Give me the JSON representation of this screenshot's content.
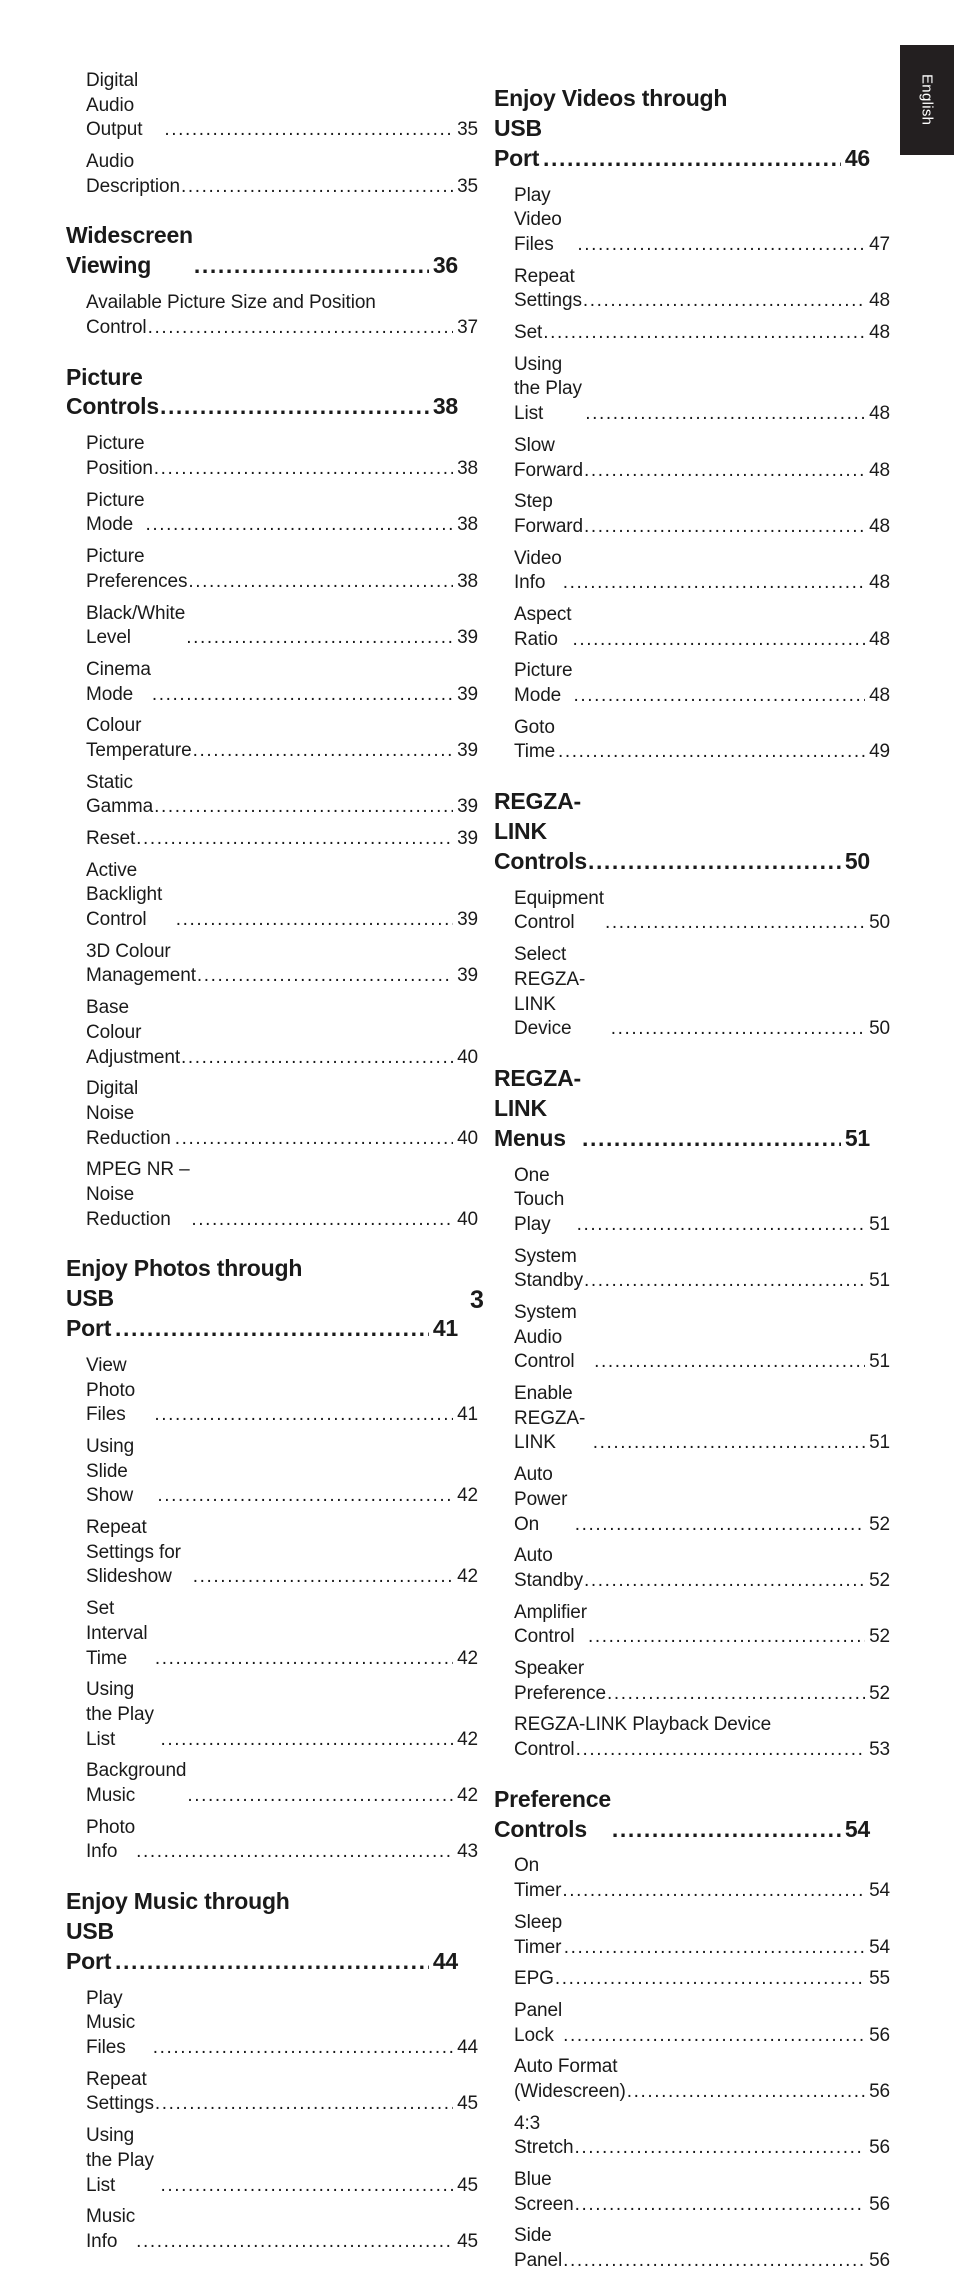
{
  "document": {
    "page_number": "3",
    "language_tab": "English"
  },
  "left_column": [
    {
      "kind": "item",
      "title": "Digital Audio Output",
      "page": "35"
    },
    {
      "kind": "item",
      "title": "Audio Description ",
      "page": "35"
    },
    {
      "kind": "chapter",
      "title": "Widescreen Viewing",
      "page": "36"
    },
    {
      "kind": "item",
      "title": "Available Picture Size and Position",
      "title2": "Control",
      "page": "37",
      "wrapped": true
    },
    {
      "kind": "chapter",
      "title": "Picture Controls",
      "page": "38"
    },
    {
      "kind": "item",
      "title": "Picture Position ",
      "page": "38"
    },
    {
      "kind": "item",
      "title": "Picture Mode ",
      "page": "38"
    },
    {
      "kind": "item",
      "title": "Picture Preferences",
      "page": "38"
    },
    {
      "kind": "item",
      "title": "Black/White Level",
      "page": "39"
    },
    {
      "kind": "item",
      "title": "Cinema Mode ",
      "page": "39"
    },
    {
      "kind": "item",
      "title": "Colour Temperature",
      "page": "39"
    },
    {
      "kind": "item",
      "title": "Static Gamma",
      "page": "39"
    },
    {
      "kind": "item",
      "title": "Reset",
      "page": "39"
    },
    {
      "kind": "item",
      "title": "Active Backlight Control ",
      "page": "39"
    },
    {
      "kind": "item",
      "title": "3D Colour Management ",
      "page": "39"
    },
    {
      "kind": "item",
      "title": "Base Colour Adjustment",
      "page": "40"
    },
    {
      "kind": "item",
      "title": "Digital Noise Reduction ",
      "page": "40"
    },
    {
      "kind": "item",
      "title": "MPEG NR – Noise Reduction ",
      "page": "40"
    },
    {
      "kind": "chapter",
      "title": "Enjoy Photos through",
      "title2": "USB Port",
      "page": "41",
      "wrapped": true
    },
    {
      "kind": "item",
      "title": "View Photo Files",
      "page": "41"
    },
    {
      "kind": "item",
      "title": "Using Slide Show ",
      "page": "42"
    },
    {
      "kind": "item",
      "title": "Repeat Settings for Slideshow ",
      "page": "42"
    },
    {
      "kind": "item",
      "title": "Set Interval Time ",
      "page": "42"
    },
    {
      "kind": "item",
      "title": "Using the Play List",
      "page": "42"
    },
    {
      "kind": "item",
      "title": "Background Music",
      "page": "42"
    },
    {
      "kind": "item",
      "title": "Photo Info",
      "page": "43"
    },
    {
      "kind": "chapter",
      "title": "Enjoy Music through",
      "title2": "USB Port",
      "page": "44",
      "wrapped": true
    },
    {
      "kind": "item",
      "title": "Play Music Files ",
      "page": "44"
    },
    {
      "kind": "item",
      "title": "Repeat Settings",
      "page": "45"
    },
    {
      "kind": "item",
      "title": "Using the Play List",
      "page": "45"
    },
    {
      "kind": "item",
      "title": "Music Info",
      "page": "45"
    }
  ],
  "right_column": [
    {
      "kind": "chapter",
      "title": "Enjoy Videos through",
      "title2": "USB Port",
      "page": "46",
      "wrapped": true
    },
    {
      "kind": "item",
      "title": "Play Video Files",
      "page": "47"
    },
    {
      "kind": "item",
      "title": "Repeat Settings",
      "page": "48"
    },
    {
      "kind": "item",
      "title": "Set ",
      "page": "48"
    },
    {
      "kind": "item",
      "title": "Using the Play List",
      "page": "48"
    },
    {
      "kind": "item",
      "title": "Slow Forward ",
      "page": "48"
    },
    {
      "kind": "item",
      "title": "Step Forward",
      "page": "48"
    },
    {
      "kind": "item",
      "title": "Video Info ",
      "page": "48"
    },
    {
      "kind": "item",
      "title": "Aspect Ratio ",
      "page": "48"
    },
    {
      "kind": "item",
      "title": "Picture Mode ",
      "page": "48"
    },
    {
      "kind": "item",
      "title": "Goto Time",
      "page": "49"
    },
    {
      "kind": "chapter",
      "title": "REGZA-LINK Controls",
      "page": "50"
    },
    {
      "kind": "item",
      "title": "Equipment Control",
      "page": "50"
    },
    {
      "kind": "item",
      "title": "Select REGZA-LINK Device",
      "page": "50"
    },
    {
      "kind": "chapter",
      "title": "REGZA-LINK Menus ",
      "page": "51"
    },
    {
      "kind": "item",
      "title": "One Touch Play ",
      "page": "51"
    },
    {
      "kind": "item",
      "title": "System Standby ",
      "page": "51"
    },
    {
      "kind": "item",
      "title": "System Audio Control",
      "page": "51"
    },
    {
      "kind": "item",
      "title": "Enable REGZA-LINK",
      "page": "51"
    },
    {
      "kind": "item",
      "title": "Auto Power On ",
      "page": "52"
    },
    {
      "kind": "item",
      "title": "Auto Standby",
      "page": "52"
    },
    {
      "kind": "item",
      "title": "Amplifier Control",
      "page": "52"
    },
    {
      "kind": "item",
      "title": "Speaker Preference ",
      "page": "52"
    },
    {
      "kind": "item",
      "title": "REGZA-LINK Playback Device",
      "title2": "Control",
      "page": "53",
      "wrapped": true
    },
    {
      "kind": "chapter",
      "title": "Preference Controls ",
      "page": "54"
    },
    {
      "kind": "item",
      "title": "On Timer",
      "page": "54"
    },
    {
      "kind": "item",
      "title": "Sleep Timer ",
      "page": "54"
    },
    {
      "kind": "item",
      "title": "EPG",
      "page": "55"
    },
    {
      "kind": "item",
      "title": "Panel Lock",
      "page": "56"
    },
    {
      "kind": "item",
      "title": "Auto Format (Widescreen) ",
      "page": "56"
    },
    {
      "kind": "item",
      "title": "4:3 Stretch",
      "page": "56"
    },
    {
      "kind": "item",
      "title": "Blue Screen",
      "page": "56"
    },
    {
      "kind": "item",
      "title": "Side Panel",
      "page": "56"
    }
  ]
}
